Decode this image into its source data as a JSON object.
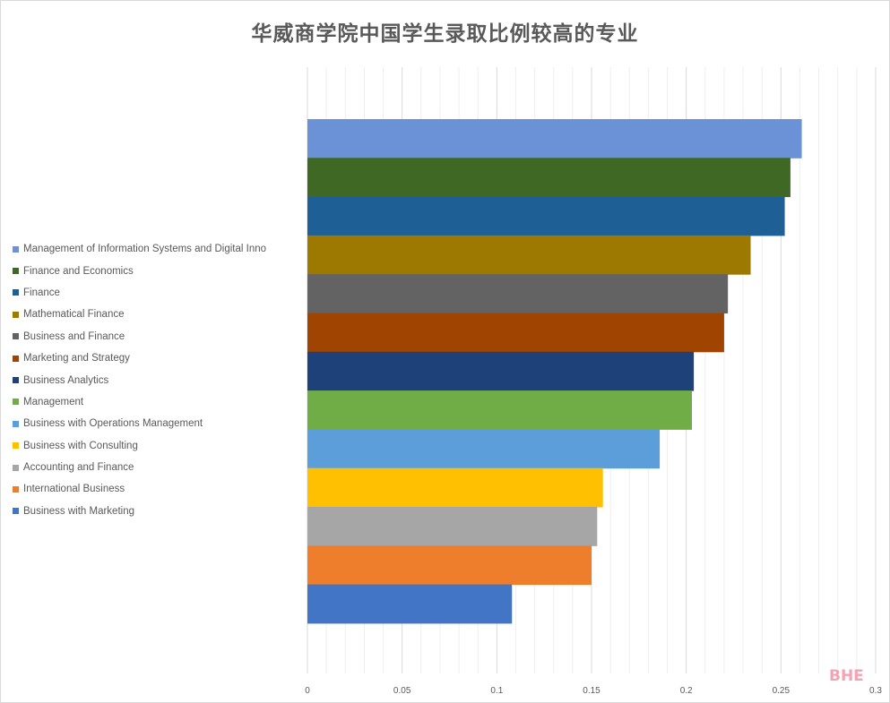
{
  "chart_data": {
    "type": "bar",
    "orientation": "horizontal",
    "title": "华威商学院中国学生录取比例较高的专业",
    "xlabel": "",
    "ylabel": "",
    "xlim": [
      0,
      0.3
    ],
    "x_ticks": [
      "0",
      "0.05",
      "0.1",
      "0.15",
      "0.2",
      "0.25",
      "0.3"
    ],
    "grid": "vertical major and minor",
    "legend_position": "left",
    "series": [
      {
        "name": "Management of Information Systems and Digital Inno",
        "value": 0.261,
        "color": "#6b91d6"
      },
      {
        "name": "Finance and Economics",
        "value": 0.255,
        "color": "#3f6824"
      },
      {
        "name": "Finance",
        "value": 0.252,
        "color": "#1e5f96"
      },
      {
        "name": "Mathematical Finance",
        "value": 0.234,
        "color": "#9e7902"
      },
      {
        "name": "Business and Finance",
        "value": 0.222,
        "color": "#636363"
      },
      {
        "name": "Marketing and Strategy",
        "value": 0.22,
        "color": "#a04401"
      },
      {
        "name": "Business Analytics",
        "value": 0.204,
        "color": "#1f417a"
      },
      {
        "name": "Management",
        "value": 0.203,
        "color": "#70ad46"
      },
      {
        "name": "Business with Operations Management",
        "value": 0.186,
        "color": "#5b9ed9"
      },
      {
        "name": "Business with Consulting",
        "value": 0.156,
        "color": "#ffc001"
      },
      {
        "name": "Accounting and Finance",
        "value": 0.153,
        "color": "#a5a6a5"
      },
      {
        "name": "International Business",
        "value": 0.15,
        "color": "#ee7e2b"
      },
      {
        "name": "Business with Marketing",
        "value": 0.108,
        "color": "#4275c6"
      }
    ]
  },
  "watermark": "BHE"
}
